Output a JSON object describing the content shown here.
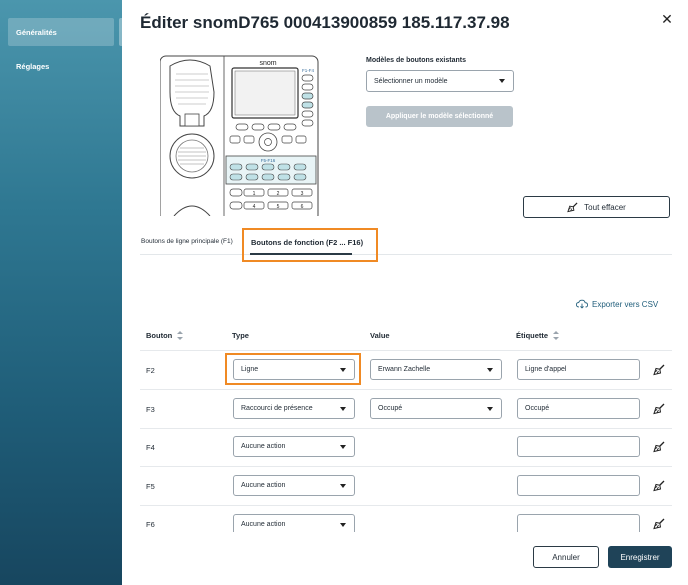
{
  "sidebar": {
    "items": [
      {
        "label": "Généralités",
        "active": true
      },
      {
        "label": "Réglages",
        "active": false
      }
    ]
  },
  "modal": {
    "title": "Éditer snomD765 000413900859 185.117.37.98",
    "phone": {
      "brand": "snom",
      "label_f1_f4": "F1-F4",
      "label_f5_f16": "F5-F16",
      "keypad": [
        "1",
        "2",
        "3",
        "4",
        "5",
        "6"
      ]
    },
    "models": {
      "label": "Modèles de boutons existants",
      "selected": "Sélectionner un modèle",
      "apply_label": "Appliquer le modèle sélectionné"
    },
    "clear_label": "Tout effacer",
    "tabs": [
      {
        "label": "Boutons de ligne principale (F1)",
        "active": false
      },
      {
        "label": "Boutons de fonction (F2 ... F16)",
        "active": true
      }
    ],
    "export_label": "Exporter vers CSV",
    "table": {
      "headers": {
        "button": "Bouton",
        "type": "Type",
        "value": "Value",
        "label": "Étiquette"
      },
      "rows": [
        {
          "key": "F2",
          "type": "Ligne",
          "value": "Erwann Zachelle",
          "label": "Ligne d'appel"
        },
        {
          "key": "F3",
          "type": "Raccourci de présence",
          "value": "Occupé",
          "label": "Occupé"
        },
        {
          "key": "F4",
          "type": "Aucune action",
          "value": "",
          "label": ""
        },
        {
          "key": "F5",
          "type": "Aucune action",
          "value": "",
          "label": ""
        },
        {
          "key": "F6",
          "type": "Aucune action",
          "value": "",
          "label": ""
        }
      ]
    },
    "cancel_label": "Annuler",
    "save_label": "Enregistrer"
  },
  "colors": {
    "highlight": "#f08a24",
    "primary": "#1f4358",
    "sidebar": "#2f7892",
    "key_teal": "#bfe1e6"
  }
}
